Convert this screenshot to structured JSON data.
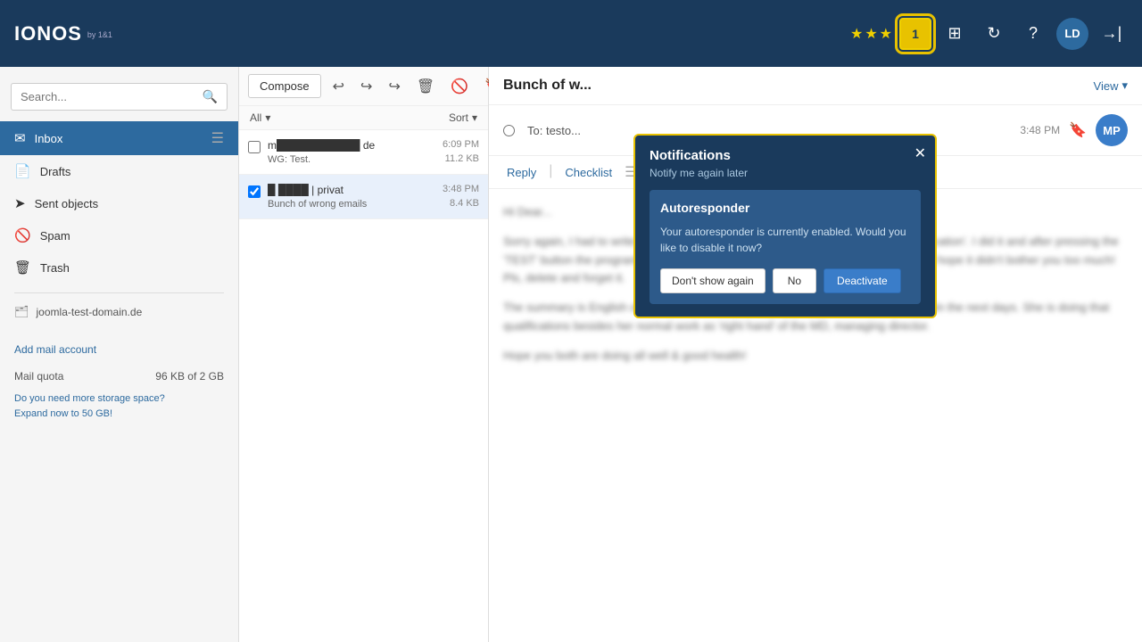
{
  "app": {
    "title": "IONOS",
    "subtitle": "by 1&1"
  },
  "nav": {
    "stars": [
      "filled",
      "filled",
      "filled"
    ],
    "notification_count": "1",
    "avatar_initials": "LD"
  },
  "sidebar": {
    "search_placeholder": "Search...",
    "folders": [
      {
        "id": "inbox",
        "label": "Inbox",
        "icon": "✉",
        "active": true,
        "has_menu": true
      },
      {
        "id": "drafts",
        "label": "Drafts",
        "icon": "📄",
        "active": false
      },
      {
        "id": "sent",
        "label": "Sent objects",
        "icon": "➤",
        "active": false
      },
      {
        "id": "spam",
        "label": "Spam",
        "icon": "🚫",
        "active": false
      },
      {
        "id": "trash",
        "label": "Trash",
        "icon": "🗑",
        "active": false
      }
    ],
    "domain": "joomla-test-domain.de",
    "add_mail_label": "Add mail account",
    "quota_label": "Mail quota",
    "quota_value": "96 KB of 2 GB",
    "promo_line1": "Do you need more storage space?",
    "promo_line2": "Expand now to 50 GB!"
  },
  "email_list": {
    "compose_label": "Compose",
    "filter_all": "All",
    "filter_sort": "Sort",
    "emails": [
      {
        "from": "m███████████ de",
        "subject": "WG: Test.",
        "time": "6:09 PM",
        "size": "11.2 KB",
        "checked": false,
        "selected": false
      },
      {
        "from": "█ ████ | privat",
        "subject": "Bunch of wrong emails",
        "time": "3:48 PM",
        "size": "8.4 KB",
        "checked": true,
        "selected": true
      }
    ]
  },
  "reading_pane": {
    "subject": "Bunch of w...",
    "view_label": "View",
    "from_label": "To:",
    "to_address": "testo...",
    "time": "3:48 PM",
    "avatar_initials": "MP",
    "reply_label": "Reply",
    "checklist_label": "Checklist",
    "greeting": "Hi Dear...",
    "body_paragraphs": [
      "Sorry again, I had to write an SEO article about 'How to manage a out of office notification'. I did it and after pressing the 'TEST' button the programme sent out some emails to my contacts, so to you both. I hope it didn't bother you too much! Pls, delete and forget it.",
      "The summary is English of the master thesis of my niece / daughter is expected within the next days. She is doing that qualifications besides her normal work as 'right hand' of the MD, managing director.",
      "Hope you both are doing all well & good health!"
    ]
  },
  "notifications": {
    "title": "Notifications",
    "subtitle": "Notify me again later",
    "autoresponder_title": "Autoresponder",
    "autoresponder_text": "Your autoresponder is currently enabled. Would you like to disable it now?",
    "btn_dont_show": "Don't show again",
    "btn_no": "No",
    "btn_deactivate": "Deactivate"
  }
}
